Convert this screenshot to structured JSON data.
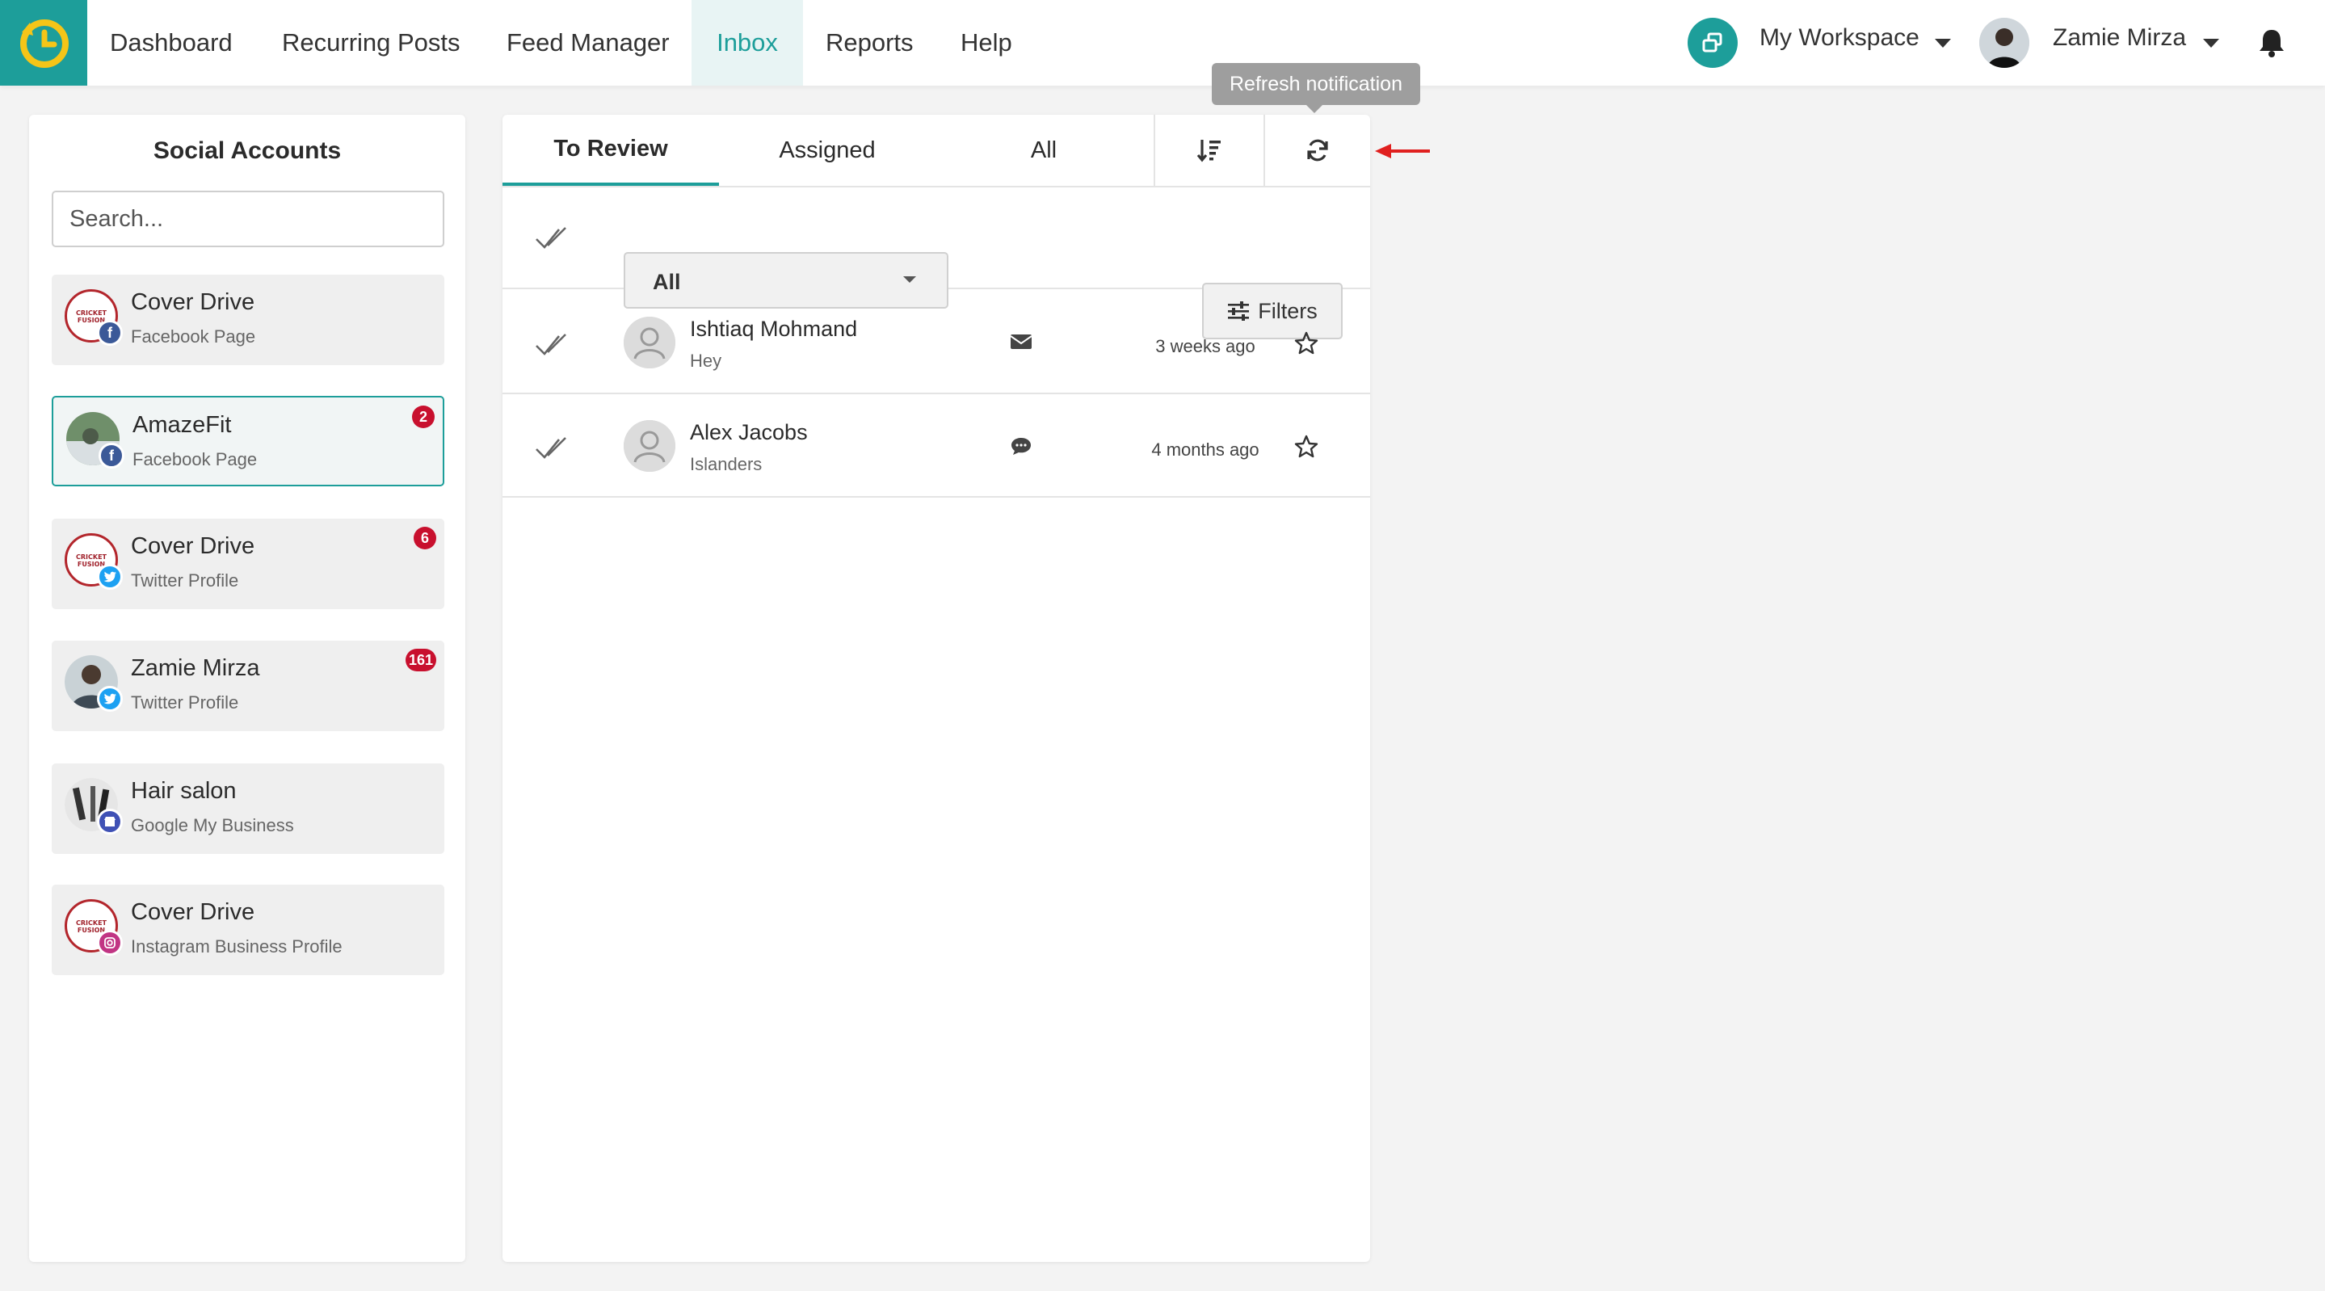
{
  "nav": {
    "items": [
      {
        "label": "Dashboard"
      },
      {
        "label": "Recurring Posts"
      },
      {
        "label": "Feed Manager"
      },
      {
        "label": "Inbox",
        "active": true
      },
      {
        "label": "Reports"
      },
      {
        "label": "Help"
      }
    ],
    "workspace_label": "My Workspace",
    "user_name": "Zamie Mirza"
  },
  "accounts_panel": {
    "title": "Social Accounts",
    "search_placeholder": "Search...",
    "accounts": [
      {
        "name": "Cover Drive",
        "type": "Facebook Page",
        "network": "facebook",
        "badge": "",
        "logo_text": "CRICKET FUSION"
      },
      {
        "name": "AmazeFit",
        "type": "Facebook Page",
        "network": "facebook",
        "badge": "2",
        "selected": true
      },
      {
        "name": "Cover Drive",
        "type": "Twitter Profile",
        "network": "twitter",
        "badge": "6",
        "logo_text": "CRICKET FUSION"
      },
      {
        "name": "Zamie Mirza",
        "type": "Twitter Profile",
        "network": "twitter",
        "badge": "161"
      },
      {
        "name": "Hair salon",
        "type": "Google My Business",
        "network": "google-my-business",
        "badge": ""
      },
      {
        "name": "Cover Drive",
        "type": "Instagram Business Profile",
        "network": "instagram",
        "badge": "",
        "logo_text": "CRICKET FUSION"
      }
    ]
  },
  "inbox": {
    "tabs": [
      {
        "label": "To Review",
        "active": true
      },
      {
        "label": "Assigned"
      },
      {
        "label": "All"
      }
    ],
    "filter_select_value": "All",
    "filters_label": "Filters",
    "tooltip": "Refresh notification",
    "messages": [
      {
        "name": "Ishtiaq Mohmand",
        "text": "Hey",
        "type_icon": "envelope-icon",
        "time": "3 weeks ago"
      },
      {
        "name": "Alex Jacobs",
        "text": "Islanders",
        "type_icon": "comment-icon",
        "time": "4 months ago"
      }
    ]
  },
  "colors": {
    "brand": "#1d9e9a",
    "badge_red": "#c8102e",
    "facebook": "#3b5998",
    "twitter": "#1da1f2",
    "instagram": "#c13584",
    "gmb": "#3f51b5",
    "annotation_arrow": "#e0201f"
  }
}
